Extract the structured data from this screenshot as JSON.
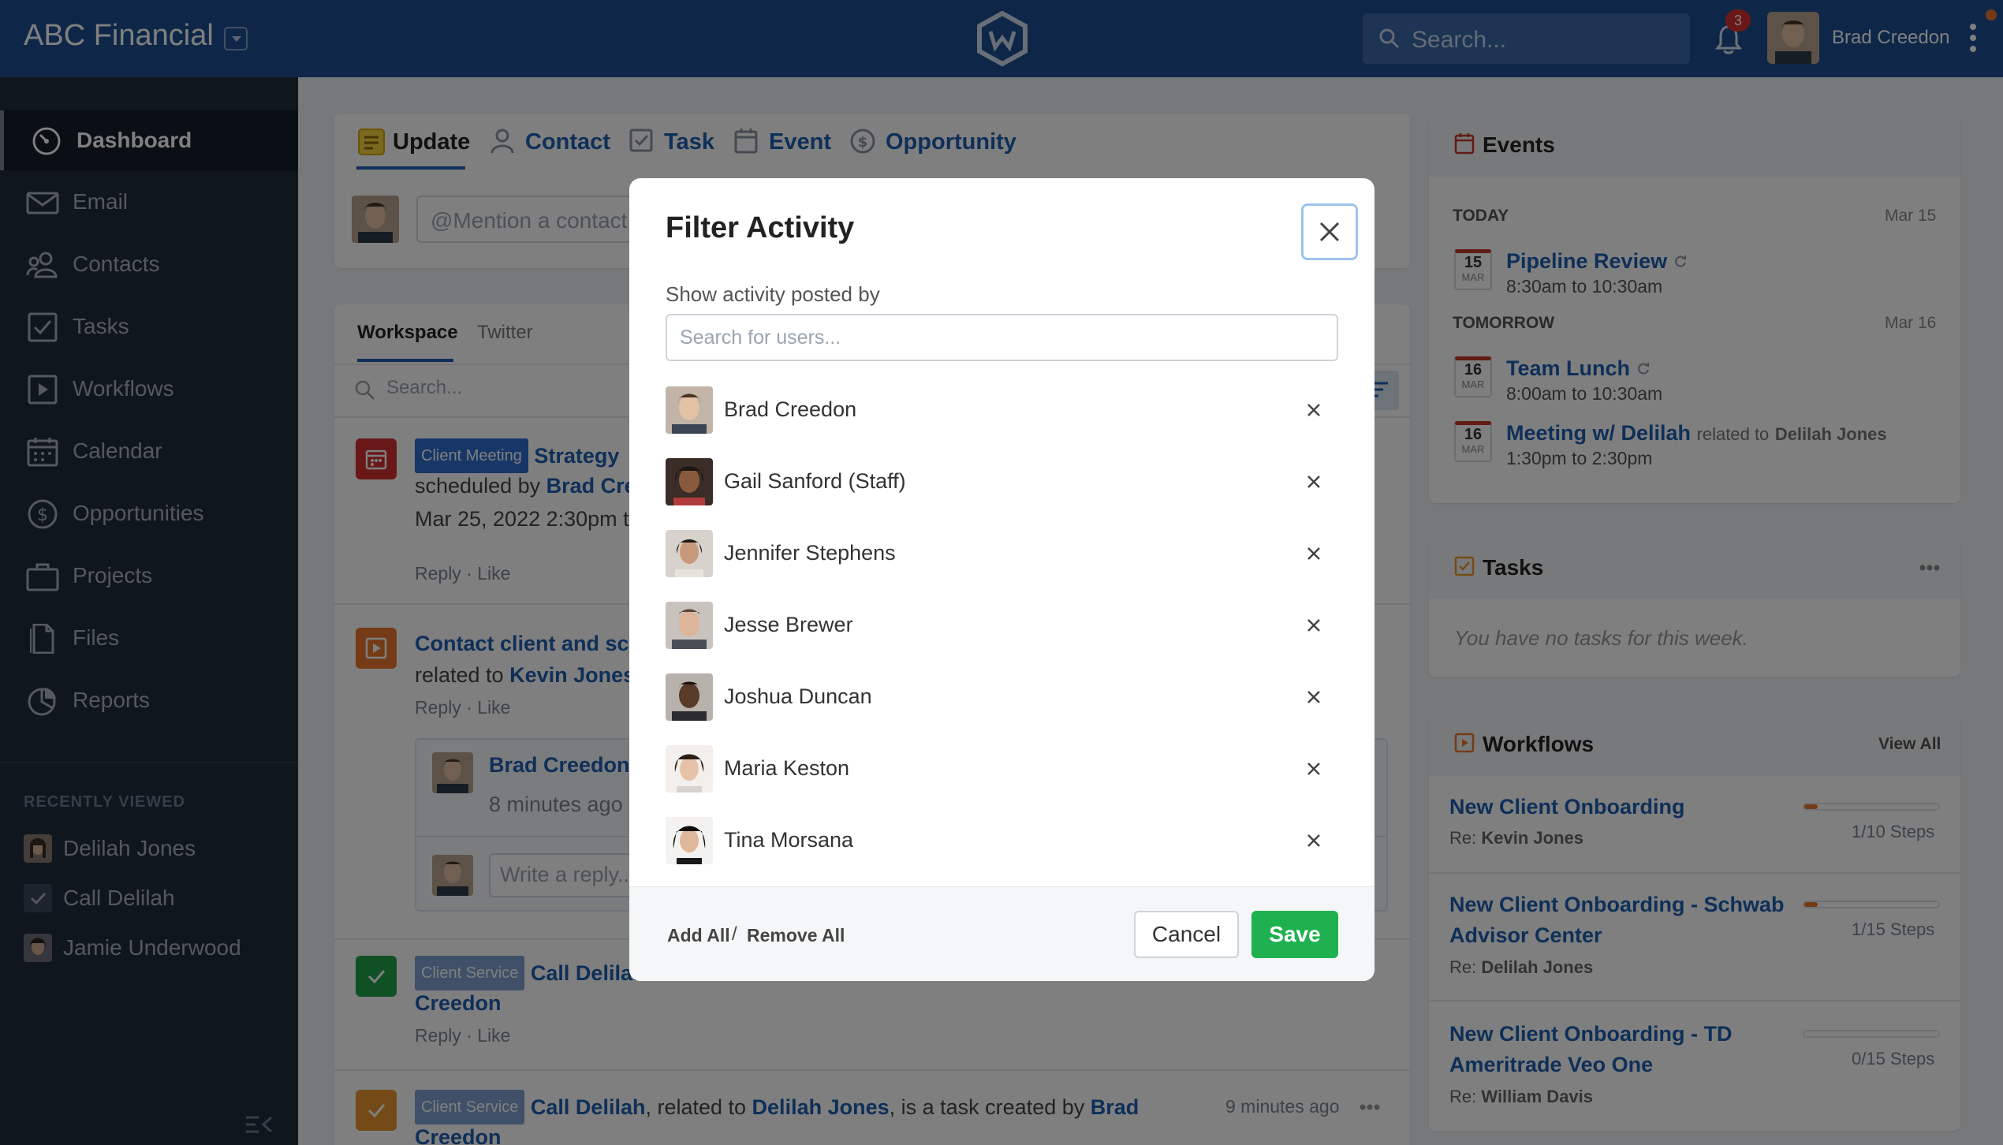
{
  "header": {
    "brand": "ABC Financial",
    "search_placeholder": "Search...",
    "notification_count": "3",
    "user_name": "Brad Creedon"
  },
  "sidebar": {
    "items": [
      {
        "label": "Dashboard",
        "icon": "dashboard-icon"
      },
      {
        "label": "Email",
        "icon": "envelope-icon"
      },
      {
        "label": "Contacts",
        "icon": "contacts-icon"
      },
      {
        "label": "Tasks",
        "icon": "checkbox-icon"
      },
      {
        "label": "Workflows",
        "icon": "play-icon"
      },
      {
        "label": "Calendar",
        "icon": "calendar-icon"
      },
      {
        "label": "Opportunities",
        "icon": "dollar-icon"
      },
      {
        "label": "Projects",
        "icon": "briefcase-icon"
      },
      {
        "label": "Files",
        "icon": "file-icon"
      },
      {
        "label": "Reports",
        "icon": "pie-chart-icon"
      }
    ],
    "recent_title": "RECENTLY VIEWED",
    "recent": [
      "Delilah Jones",
      "Call Delilah",
      "Jamie Underwood"
    ]
  },
  "composer": {
    "tabs": [
      "Update",
      "Contact",
      "Task",
      "Event",
      "Opportunity"
    ],
    "placeholder": "@Mention a contact"
  },
  "feed": {
    "tabs": [
      "Workspace",
      "Twitter"
    ],
    "search_placeholder": "Search...",
    "item1": {
      "tag": "Client Meeting",
      "title": "Strategy",
      "line2_pre": "scheduled by",
      "line2_link": "Brad Cre",
      "line3": "Mar 25, 2022 2:30pm t",
      "actions": "Reply · Like"
    },
    "item2": {
      "title": "Contact client and sch",
      "line2_pre": "related to",
      "line2_link": "Kevin Jones",
      "actions": "Reply · Like",
      "comment_author": "Brad Creedon",
      "comment_time": "8 minutes ago",
      "reply_placeholder": "Write a reply..."
    },
    "item3": {
      "tag": "Client Service",
      "title": "Call Delilah",
      "line2": "Creedon",
      "actions": "Reply · Like"
    },
    "item4": {
      "tag": "Client Service",
      "link1": "Call Delilah",
      "text1": ", related to ",
      "link2": "Delilah Jones",
      "text2": ", is a task created by ",
      "link3": "Brad",
      "line2": "Creedon",
      "time": "9 minutes ago"
    }
  },
  "events": {
    "title": "Events",
    "today_label": "TODAY",
    "today_date": "Mar 15",
    "tomorrow_label": "TOMORROW",
    "tomorrow_date": "Mar 16",
    "items": [
      {
        "day": "15",
        "month": "MAR",
        "title": "Pipeline Review",
        "time": "8:30am to 10:30am"
      },
      {
        "day": "16",
        "month": "MAR",
        "title": "Team Lunch",
        "time": "8:00am to 10:30am"
      },
      {
        "day": "16",
        "month": "MAR",
        "title": "Meeting w/ Delilah",
        "related_pre": "related to",
        "related": "Delilah Jones",
        "time": "1:30pm to 2:30pm"
      }
    ]
  },
  "tasks": {
    "title": "Tasks",
    "empty": "You have no tasks for this week."
  },
  "workflows": {
    "title": "Workflows",
    "view_all": "View All",
    "items": [
      {
        "title": "New Client Onboarding",
        "re_label": "Re:",
        "re": "Kevin Jones",
        "steps": "1/10 Steps",
        "progress": 0.1
      },
      {
        "title": "New Client Onboarding - Schwab Advisor Center",
        "re_label": "Re:",
        "re": "Delilah Jones",
        "steps": "1/15 Steps",
        "progress": 0.067
      },
      {
        "title": "New Client Onboarding - TD Ameritrade Veo One",
        "re_label": "Re:",
        "re": "William Davis",
        "steps": "0/15 Steps",
        "progress": 0
      }
    ]
  },
  "modal": {
    "title": "Filter Activity",
    "subtitle": "Show activity posted by",
    "search_placeholder": "Search for users...",
    "users": [
      "Brad Creedon",
      "Gail Sanford (Staff)",
      "Jennifer Stephens",
      "Jesse Brewer",
      "Joshua Duncan",
      "Maria Keston",
      "Tina Morsana"
    ],
    "add_all": "Add All",
    "separator": "/",
    "remove_all": "Remove All",
    "cancel": "Cancel",
    "save": "Save"
  },
  "colors": {
    "header": "#1d4f92",
    "sidebar": "#212c3d",
    "link": "#1d5fb0",
    "save": "#1fb14f",
    "accent_orange": "#e8762c"
  }
}
